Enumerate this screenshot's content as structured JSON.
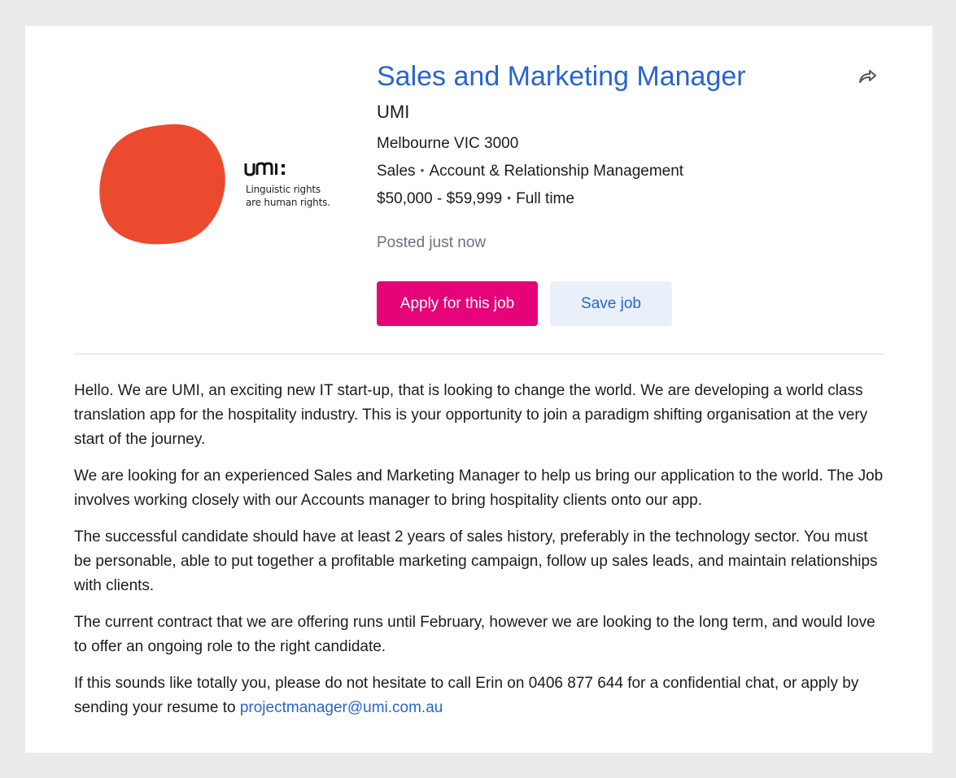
{
  "job": {
    "title": "Sales and Marketing Manager",
    "company": "UMI",
    "location": "Melbourne VIC 3000",
    "classification": "Sales",
    "subclassification": "Account & Relationship Management",
    "salary": "$50,000 - $59,999",
    "work_type": "Full time",
    "posted": "Posted just now"
  },
  "logo": {
    "wordmark": "umi:",
    "tagline_line1": "Linguistic rights",
    "tagline_line2": "are human rights.",
    "blob_color": "#ec4a2e"
  },
  "actions": {
    "apply_label": "Apply for this job",
    "save_label": "Save job",
    "share_icon": "share-arrow-icon"
  },
  "description": {
    "p1": "Hello. We are UMI, an exciting new IT start-up, that is looking to change the world. We are developing a world class translation app for the hospitality industry. This is your opportunity to join a paradigm shifting organisation at the very start of the journey.",
    "p2": "We are looking for an experienced Sales and Marketing Manager to help us bring our application to the world. The Job involves working closely with our Accounts manager to bring hospitality clients onto our app.",
    "p3": "The successful candidate should have at least 2 years of sales history, preferably in the technology sector. You must be personable, able to put together a profitable marketing campaign, follow up sales leads, and maintain relationships with clients.",
    "p4": "The current contract that we are offering runs until February, however we are looking to the long term, and would love to offer an ongoing role to the right candidate.",
    "p5_text": "If this sounds like totally you, please do not hesitate to call Erin on 0406 877 644 for a confidential chat, or apply by sending your resume to ",
    "p5_email": "projectmanager@umi.com.au"
  },
  "colors": {
    "title_blue": "#2765cf",
    "apply_pink": "#e60278",
    "save_bg": "#eaf0fa",
    "muted": "#6b7280"
  }
}
